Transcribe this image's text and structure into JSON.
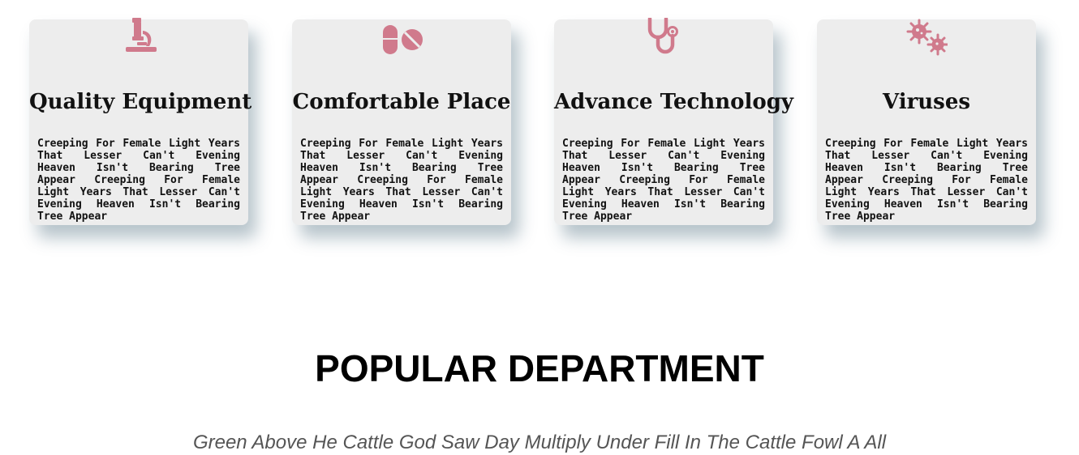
{
  "colors": {
    "icon": "#d07a8c",
    "card_bg": "#ededed",
    "heading": "#000000"
  },
  "features": [
    {
      "icon": "microscope-icon",
      "title": "Quality Equipment",
      "text": "Creeping For Female Light Years That Lesser Can't Evening Heaven Isn't Bearing Tree Appear Creeping For Female Light Years That Lesser Can't Evening Heaven Isn't Bearing Tree Appear"
    },
    {
      "icon": "pills-icon",
      "title": "Comfortable Place",
      "text": "Creeping For Female Light Years That Lesser Can't Evening Heaven Isn't Bearing Tree Appear Creeping For Female Light Years That Lesser Can't Evening Heaven Isn't Bearing Tree Appear"
    },
    {
      "icon": "stethoscope-icon",
      "title": "Advance Technology",
      "text": "Creeping For Female Light Years That Lesser Can't Evening Heaven Isn't Bearing Tree Appear Creeping For Female Light Years That Lesser Can't Evening Heaven Isn't Bearing Tree Appear"
    },
    {
      "icon": "virus-icon",
      "title": "Viruses",
      "text": "Creeping For Female Light Years That Lesser Can't Evening Heaven Isn't Bearing Tree Appear Creeping For Female Light Years That Lesser Can't Evening Heaven Isn't Bearing Tree Appear"
    }
  ],
  "department": {
    "title": "POPULAR DEPARTMENT",
    "subtitle": "Green Above He Cattle God Saw Day Multiply Under Fill In The Cattle Fowl A All"
  }
}
